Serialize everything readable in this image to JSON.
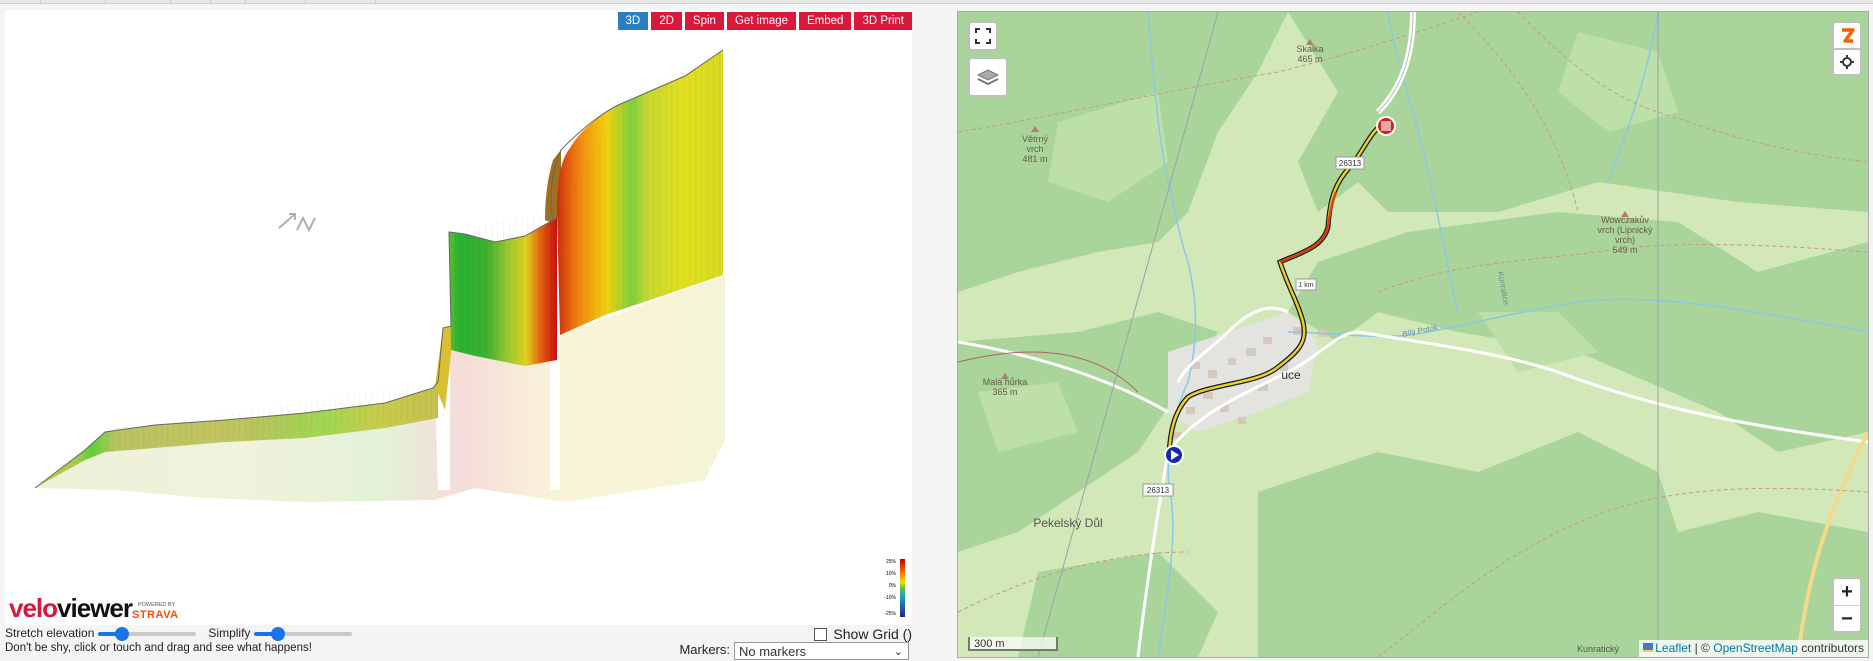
{
  "profile_view": {
    "buttons": [
      {
        "label": "3D",
        "active": true
      },
      {
        "label": "2D",
        "active": false
      },
      {
        "label": "Spin",
        "active": false
      },
      {
        "label": "Get image",
        "active": false
      },
      {
        "label": "Embed",
        "active": false
      },
      {
        "label": "3D Print",
        "active": false
      }
    ],
    "compass_icon": "north-arrow-icon",
    "gradient_legend": [
      "25%",
      "10%",
      "0%",
      "-10%",
      "-25%"
    ],
    "logo": {
      "brand_left": "velo",
      "brand_right": "viewer",
      "powered_by": "POWERED BY",
      "partner": "STRAVA"
    }
  },
  "controls": {
    "stretch_label": "Stretch elevation",
    "stretch_value": 0.25,
    "simplify_label": "Simplify",
    "simplify_value": 0.25,
    "show_grid_label": "Show Grid ()",
    "show_grid_checked": false,
    "hint": "Don't be shy, click or touch and drag and see what happens!",
    "markers_label": "Markers:",
    "markers_value": "No markers"
  },
  "map": {
    "fullscreen_icon": "fullscreen-icon",
    "layers_icon": "layers-icon",
    "strava_icon": "zwift-z-icon",
    "settings_icon": "gear-icon",
    "zoom_in": "+",
    "zoom_out": "−",
    "scale": "300 m",
    "labels": {
      "skalka_name": "Skalka",
      "skalka_elev": "465 m",
      "vetrny_name": "Větrný",
      "vetrny_name2": "vrch",
      "vetrny_elev": "481 m",
      "wowcz_name": "Wowczakův",
      "wowcz_name2": "vrch (Lipnický",
      "wowcz_name3": "vrch)",
      "wowcz_elev": "549 m",
      "mala_name": "Malá hůrka",
      "mala_elev": "365 m",
      "pekelsky": "Pekelský Důl",
      "kunraticky": "Kunratický",
      "kunratice_stream": "Kunratice",
      "luce": "uce",
      "bily_potok": "Bílý Potok",
      "road_26313_top": "26313",
      "road_26313_bottom": "26313",
      "km_marker": "1 km"
    },
    "attribution": {
      "leaflet": "Leaflet",
      "separator": "| ©",
      "osm": "OpenStreetMap",
      "contributors": "contributors"
    }
  }
}
